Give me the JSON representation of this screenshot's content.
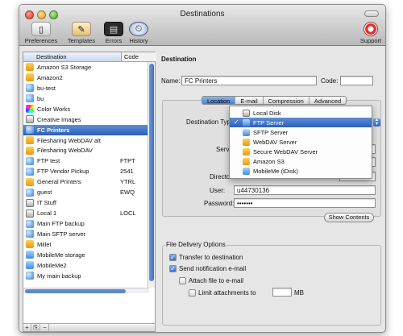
{
  "window": {
    "title": "Destinations"
  },
  "toolbar": {
    "items": [
      {
        "label": "Preferences",
        "icon": "preferences-icon"
      },
      {
        "label": "Templates",
        "icon": "templates-icon"
      },
      {
        "label": "Errors",
        "icon": "errors-icon"
      },
      {
        "label": "History",
        "icon": "history-icon"
      }
    ],
    "support_label": "Support"
  },
  "sidebar": {
    "col_destination": "Destination",
    "col_code": "Code",
    "items": [
      {
        "name": "Amazon S3 Storage",
        "code": "",
        "icon": "box"
      },
      {
        "name": "Amazon2",
        "code": "",
        "icon": "box"
      },
      {
        "name": "bu-test",
        "code": "",
        "icon": "globe"
      },
      {
        "name": "bu",
        "code": "",
        "icon": "globe"
      },
      {
        "name": "Color Works",
        "code": "",
        "icon": "color"
      },
      {
        "name": "Creative Images",
        "code": "",
        "icon": "disk"
      },
      {
        "name": "FC Printers",
        "code": "",
        "icon": "globe",
        "selected": true
      },
      {
        "name": "Filesharing WebDAV alt",
        "code": "",
        "icon": "box"
      },
      {
        "name": "Filesharing WebDAV",
        "code": "",
        "icon": "box"
      },
      {
        "name": "FTP test",
        "code": "FTPT",
        "icon": "globe"
      },
      {
        "name": "FTP Vendor Pickup",
        "code": "2541",
        "icon": "globe"
      },
      {
        "name": "General Printers",
        "code": "YTRL",
        "icon": "box"
      },
      {
        "name": "guest",
        "code": "EWQ",
        "icon": "globe"
      },
      {
        "name": "IT Stuff",
        "code": "",
        "icon": "disk"
      },
      {
        "name": "Local 1",
        "code": "LOCL",
        "icon": "disk"
      },
      {
        "name": "Main FTP backup",
        "code": "",
        "icon": "globe"
      },
      {
        "name": "Main SFTP server",
        "code": "",
        "icon": "globe"
      },
      {
        "name": "Millet",
        "code": "",
        "icon": "box"
      },
      {
        "name": "MobileMe storage",
        "code": "",
        "icon": "mobileme"
      },
      {
        "name": "MobileMe2",
        "code": "",
        "icon": "mobileme"
      },
      {
        "name": "My main backup",
        "code": "",
        "icon": "globe"
      }
    ],
    "buttons": [
      "+",
      "⎘",
      "−"
    ]
  },
  "detail": {
    "section_title": "Destination",
    "name_label": "Name:",
    "name_value": "FC Printers",
    "code_label": "Code:",
    "code_value": "",
    "tabs": [
      {
        "label": "Location",
        "active": true
      },
      {
        "label": "E-mail",
        "active": false
      },
      {
        "label": "Compression",
        "active": false
      },
      {
        "label": "Advanced",
        "active": false
      }
    ],
    "destination_type_label": "Destination Type",
    "destination_type_value": "FTP Server",
    "destination_type_options": [
      {
        "label": "Local Disk",
        "icon": "disk"
      },
      {
        "label": "FTP Server",
        "icon": "ftp",
        "selected": true
      },
      {
        "label": "SFTP Server",
        "icon": "ftp"
      },
      {
        "label": "WebDAV Server",
        "icon": "box"
      },
      {
        "label": "Secure WebDAV Server",
        "icon": "box"
      },
      {
        "label": "Amazon S3",
        "icon": "box"
      },
      {
        "label": "MobileMe (iDisk)",
        "icon": "mobileme"
      }
    ],
    "server_label": "Serve",
    "directory_label": "Directo",
    "user_label": "User:",
    "user_value": "u44730136",
    "password_label": "Password:",
    "password_value": "•••••••",
    "show_contents_label": "Show Contents"
  },
  "delivery": {
    "title": "File Delivery Options",
    "transfer_label": "Transfer to destination",
    "transfer_checked": true,
    "notify_label": "Send notification e-mail",
    "notify_checked": true,
    "attach_label": "Attach file to e-mail",
    "attach_checked": false,
    "limit_label": "Limit attachments to",
    "limit_checked": false,
    "limit_value": "",
    "limit_unit": "MB"
  }
}
